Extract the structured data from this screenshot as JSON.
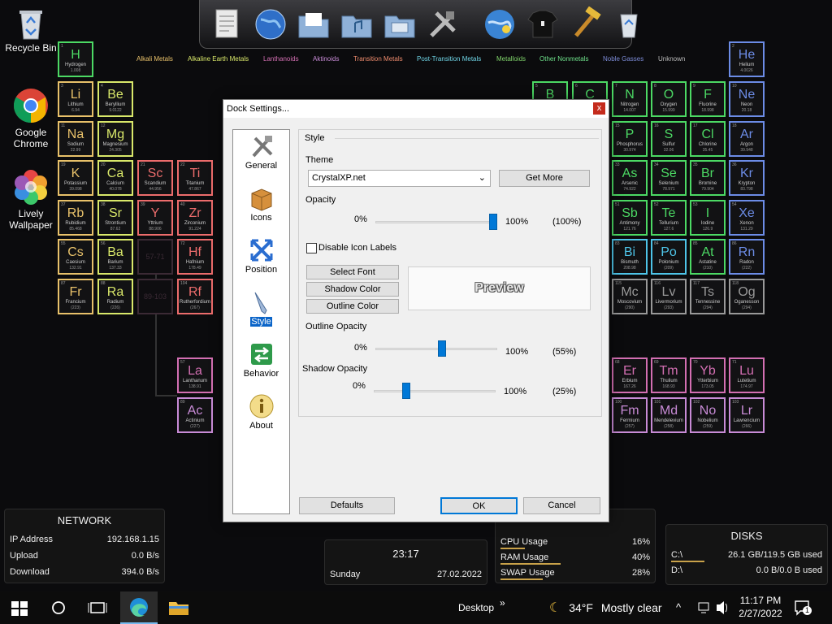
{
  "desktop": {
    "icons": [
      {
        "label": "Recycle Bin"
      },
      {
        "label": "Google Chrome"
      },
      {
        "label": "Lively Wallpaper"
      }
    ]
  },
  "dock": {
    "icons": [
      "notepad-icon",
      "globe-icon",
      "folder-docs-icon",
      "folder-music-icon",
      "folder-pictures-icon",
      "tools-icon",
      "internet-icon",
      "tshirt-icon",
      "hammer-icon",
      "recycle-icon"
    ]
  },
  "periodic": {
    "legend": [
      {
        "label": "Alkali Metals",
        "color": "#e8c16a"
      },
      {
        "label": "Alkaline Earth Metals",
        "color": "#d9e86a"
      },
      {
        "label": "Lanthanoids",
        "color": "#d36fb2"
      },
      {
        "label": "Aktinoids",
        "color": "#c88bd6"
      },
      {
        "label": "Transition Metals",
        "color": "#ec8a6c"
      },
      {
        "label": "Post-Transition Metals",
        "color": "#6fd5e6"
      },
      {
        "label": "Metalloids",
        "color": "#7fd36a"
      },
      {
        "label": "Other Nonmetals",
        "color": "#6ee08a"
      },
      {
        "label": "Noble Gasses",
        "color": "#7c8bd6"
      },
      {
        "label": "Unknown",
        "color": "#bbbbbb"
      }
    ],
    "elements": [
      {
        "n": "1",
        "s": "H",
        "name": "Hydrogen",
        "w": "1.008",
        "c": "#4cd964"
      },
      {
        "n": "2",
        "s": "He",
        "name": "Helium",
        "w": "4.0026",
        "c": "#6c8ce6"
      },
      {
        "n": "3",
        "s": "Li",
        "name": "Lithium",
        "w": "6.94",
        "c": "#e8c16a"
      },
      {
        "n": "4",
        "s": "Be",
        "name": "Beryllium",
        "w": "9.0122",
        "c": "#d9e86a"
      },
      {
        "n": "5",
        "s": "B",
        "name": "",
        "w": "",
        "c": "#4cd964"
      },
      {
        "n": "6",
        "s": "C",
        "name": "",
        "w": "",
        "c": "#4cd964"
      },
      {
        "n": "7",
        "s": "N",
        "name": "Nitrogen",
        "w": "14.007",
        "c": "#4cd964"
      },
      {
        "n": "8",
        "s": "O",
        "name": "Oxygen",
        "w": "15.999",
        "c": "#4cd964"
      },
      {
        "n": "9",
        "s": "F",
        "name": "Fluorine",
        "w": "18.998",
        "c": "#4cd964"
      },
      {
        "n": "10",
        "s": "Ne",
        "name": "Neon",
        "w": "20.18",
        "c": "#6c8ce6"
      },
      {
        "n": "11",
        "s": "Na",
        "name": "Sodium",
        "w": "22.99",
        "c": "#e8c16a"
      },
      {
        "n": "12",
        "s": "Mg",
        "name": "Magnesium",
        "w": "24.305",
        "c": "#d9e86a"
      },
      {
        "n": "15",
        "s": "P",
        "name": "Phosphorus",
        "w": "30.974",
        "c": "#4cd964"
      },
      {
        "n": "16",
        "s": "S",
        "name": "Sulfur",
        "w": "32.06",
        "c": "#4cd964"
      },
      {
        "n": "17",
        "s": "Cl",
        "name": "Chlorine",
        "w": "35.45",
        "c": "#4cd964"
      },
      {
        "n": "18",
        "s": "Ar",
        "name": "Argon",
        "w": "39.948",
        "c": "#6c8ce6"
      },
      {
        "n": "19",
        "s": "K",
        "name": "Potassium",
        "w": "39.098",
        "c": "#e8c16a"
      },
      {
        "n": "20",
        "s": "Ca",
        "name": "Calcium",
        "w": "40.078",
        "c": "#d9e86a"
      },
      {
        "n": "21",
        "s": "Sc",
        "name": "Scandium",
        "w": "44.956",
        "c": "#ec6c6c"
      },
      {
        "n": "22",
        "s": "Ti",
        "name": "Titanium",
        "w": "47.867",
        "c": "#ec6c6c"
      },
      {
        "n": "33",
        "s": "As",
        "name": "Arsenic",
        "w": "74.922",
        "c": "#4cd964"
      },
      {
        "n": "34",
        "s": "Se",
        "name": "Selenium",
        "w": "78.971",
        "c": "#4cd964"
      },
      {
        "n": "35",
        "s": "Br",
        "name": "Bromine",
        "w": "79.904",
        "c": "#4cd964"
      },
      {
        "n": "36",
        "s": "Kr",
        "name": "Krypton",
        "w": "83.798",
        "c": "#6c8ce6"
      },
      {
        "n": "37",
        "s": "Rb",
        "name": "Rubidium",
        "w": "85.468",
        "c": "#e8c16a"
      },
      {
        "n": "38",
        "s": "Sr",
        "name": "Strontium",
        "w": "87.62",
        "c": "#d9e86a"
      },
      {
        "n": "39",
        "s": "Y",
        "name": "Yttrium",
        "w": "88.906",
        "c": "#ec6c6c"
      },
      {
        "n": "40",
        "s": "Zr",
        "name": "Zirconium",
        "w": "91.224",
        "c": "#ec6c6c"
      },
      {
        "n": "51",
        "s": "Sb",
        "name": "Antimony",
        "w": "121.76",
        "c": "#4cd964"
      },
      {
        "n": "52",
        "s": "Te",
        "name": "Tellurium",
        "w": "127.6",
        "c": "#4cd964"
      },
      {
        "n": "53",
        "s": "I",
        "name": "Iodine",
        "w": "126.9",
        "c": "#4cd964"
      },
      {
        "n": "54",
        "s": "Xe",
        "name": "Xenon",
        "w": "131.29",
        "c": "#6c8ce6"
      },
      {
        "n": "55",
        "s": "Cs",
        "name": "Caesium",
        "w": "132.91",
        "c": "#e8c16a"
      },
      {
        "n": "56",
        "s": "Ba",
        "name": "Barium",
        "w": "137.33",
        "c": "#d9e86a"
      },
      {
        "n": "72",
        "s": "Hf",
        "name": "Hafnium",
        "w": "178.49",
        "c": "#ec6c6c"
      },
      {
        "n": "83",
        "s": "Bi",
        "name": "Bismuth",
        "w": "208.98",
        "c": "#4ec4e8"
      },
      {
        "n": "84",
        "s": "Po",
        "name": "Polonium",
        "w": "(209)",
        "c": "#4ec4e8"
      },
      {
        "n": "85",
        "s": "At",
        "name": "Astatine",
        "w": "(210)",
        "c": "#4cd964"
      },
      {
        "n": "86",
        "s": "Rn",
        "name": "Radon",
        "w": "(222)",
        "c": "#6c8ce6"
      },
      {
        "n": "87",
        "s": "Fr",
        "name": "Francium",
        "w": "(223)",
        "c": "#e8c16a"
      },
      {
        "n": "88",
        "s": "Ra",
        "name": "Radium",
        "w": "(226)",
        "c": "#d9e86a"
      },
      {
        "n": "104",
        "s": "Rf",
        "name": "Rutherfordium",
        "w": "(267)",
        "c": "#ec6c6c"
      },
      {
        "n": "115",
        "s": "Mc",
        "name": "Moscovium",
        "w": "(290)",
        "c": "#999999"
      },
      {
        "n": "116",
        "s": "Lv",
        "name": "Livermorium",
        "w": "(293)",
        "c": "#999999"
      },
      {
        "n": "117",
        "s": "Ts",
        "name": "Tennessine",
        "w": "(294)",
        "c": "#999999"
      },
      {
        "n": "118",
        "s": "Og",
        "name": "Oganesson",
        "w": "(294)",
        "c": "#999999"
      },
      {
        "n": "57",
        "s": "La",
        "name": "Lanthanum",
        "w": "138.91",
        "c": "#d36fb2"
      },
      {
        "n": "68",
        "s": "Er",
        "name": "Erbium",
        "w": "167.26",
        "c": "#d36fb2"
      },
      {
        "n": "69",
        "s": "Tm",
        "name": "Thulium",
        "w": "168.93",
        "c": "#d36fb2"
      },
      {
        "n": "70",
        "s": "Yb",
        "name": "Ytterbium",
        "w": "173.05",
        "c": "#d36fb2"
      },
      {
        "n": "71",
        "s": "Lu",
        "name": "Lutetium",
        "w": "174.97",
        "c": "#d36fb2"
      },
      {
        "n": "89",
        "s": "Ac",
        "name": "Actinium",
        "w": "(227)",
        "c": "#c88bd6"
      },
      {
        "n": "100",
        "s": "Fm",
        "name": "Fermium",
        "w": "(257)",
        "c": "#c88bd6"
      },
      {
        "n": "101",
        "s": "Md",
        "name": "Mendelevium",
        "w": "(258)",
        "c": "#c88bd6"
      },
      {
        "n": "102",
        "s": "No",
        "name": "Nobelium",
        "w": "(259)",
        "c": "#c88bd6"
      },
      {
        "n": "103",
        "s": "Lr",
        "name": "Lawrencium",
        "w": "(266)",
        "c": "#c88bd6"
      }
    ],
    "placeholders": [
      "57-71",
      "89-103"
    ]
  },
  "dialog": {
    "title": "Dock Settings...",
    "close": "x",
    "nav": [
      {
        "label": "General",
        "icon": "tools-icon"
      },
      {
        "label": "Icons",
        "icon": "box-icon"
      },
      {
        "label": "Position",
        "icon": "arrows-icon"
      },
      {
        "label": "Style",
        "icon": "pen-icon"
      },
      {
        "label": "Behavior",
        "icon": "switch-icon"
      },
      {
        "label": "About",
        "icon": "info-icon"
      }
    ],
    "style": {
      "group": "Style",
      "theme_label": "Theme",
      "theme_value": "CrystalXP.net",
      "get_more": "Get More",
      "opacity_label": "Opacity",
      "opacity_min": "0%",
      "opacity_max": "100%",
      "opacity_value": "(100%)",
      "opacity": 1.0,
      "disable_labels": "Disable Icon Labels",
      "disable_labels_checked": false,
      "select_font": "Select Font",
      "shadow_color": "Shadow Color",
      "outline_color": "Outline Color",
      "preview": "Preview",
      "outline_label": "Outline Opacity",
      "outline_min": "0%",
      "outline_max": "100%",
      "outline_value": "(55%)",
      "outline": 0.55,
      "shadow_label": "Shadow Opacity",
      "shadow_min": "0%",
      "shadow_max": "100%",
      "shadow_value": "(25%)",
      "shadow": 0.25
    },
    "buttons": {
      "defaults": "Defaults",
      "ok": "OK",
      "cancel": "Cancel"
    }
  },
  "widgets": {
    "network": {
      "title": "NETWORK",
      "rows": [
        {
          "k": "IP Address",
          "v": "192.168.1.15"
        },
        {
          "k": "Upload",
          "v": "0.0 B/s"
        },
        {
          "k": "Download",
          "v": "394.0 B/s"
        }
      ]
    },
    "clock": {
      "time": "23:17",
      "day": "Sunday",
      "date": "27.02.2022"
    },
    "system": {
      "rows": [
        {
          "k": "CPU Usage",
          "v": "16%",
          "u": 0.16
        },
        {
          "k": "RAM Usage",
          "v": "40%",
          "u": 0.4
        },
        {
          "k": "SWAP Usage",
          "v": "28%",
          "u": 0.28
        }
      ]
    },
    "disks": {
      "title": "DISKS",
      "rows": [
        {
          "k": "C:\\",
          "v": "26.1 GB/119.5 GB used",
          "u": 0.22
        },
        {
          "k": "D:\\",
          "v": "0.0 B/0.0 B used",
          "u": 0
        }
      ]
    }
  },
  "taskbar": {
    "desktop": "Desktop",
    "chevron": "»",
    "temp": "34°F",
    "weather": "Mostly clear",
    "time": "11:17 PM",
    "date": "2/27/2022",
    "notif_count": "1"
  }
}
